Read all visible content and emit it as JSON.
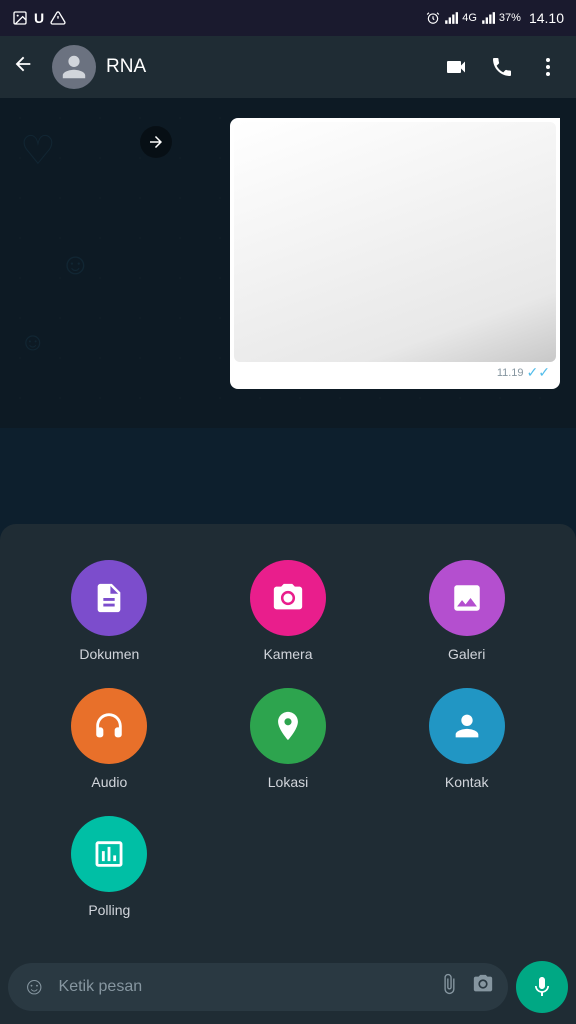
{
  "statusBar": {
    "time": "14.10",
    "battery": "37%",
    "signal": "4G"
  },
  "header": {
    "backLabel": "←",
    "contactName": "RNA",
    "videoCallLabel": "video-call",
    "phoneCallLabel": "phone-call",
    "moreLabel": "more"
  },
  "message": {
    "timestamp": "11.19",
    "ticks": "✓✓"
  },
  "attachmentPanel": {
    "items": [
      {
        "id": "dokumen",
        "label": "Dokumen",
        "color": "bg-purple",
        "icon": "document"
      },
      {
        "id": "kamera",
        "label": "Kamera",
        "color": "bg-pink",
        "icon": "camera"
      },
      {
        "id": "galeri",
        "label": "Galeri",
        "color": "bg-violet",
        "icon": "gallery"
      },
      {
        "id": "audio",
        "label": "Audio",
        "color": "bg-orange",
        "icon": "headphone"
      },
      {
        "id": "lokasi",
        "label": "Lokasi",
        "color": "bg-green",
        "icon": "location"
      },
      {
        "id": "kontak",
        "label": "Kontak",
        "color": "bg-cyan",
        "icon": "contact"
      },
      {
        "id": "polling",
        "label": "Polling",
        "color": "bg-teal",
        "icon": "polling"
      }
    ]
  },
  "inputBar": {
    "placeholder": "Ketik pesan"
  }
}
